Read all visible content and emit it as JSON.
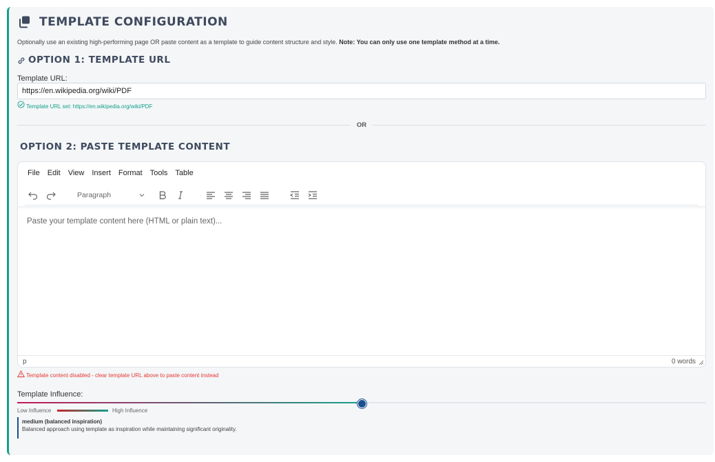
{
  "header": {
    "title": "Template Configuration",
    "icon": "copy-icon",
    "subtitle": "Optionally use an existing high-performing page OR paste content as a template to guide content structure and style.",
    "note": "Note: You can only use one template method at a time."
  },
  "option1": {
    "title": "Option 1: Template URL",
    "icon": "link-icon",
    "url_label": "Template URL:",
    "url_value": "https://en.wikipedia.org/wiki/PDF",
    "status": "Template URL set: https://en.wikipedia.org/wiki/PDF"
  },
  "divider": {
    "text": "OR"
  },
  "option2": {
    "title": "Option 2: Paste Template Content",
    "menu": [
      "File",
      "Edit",
      "View",
      "Insert",
      "Format",
      "Tools",
      "Table"
    ],
    "block_format": "Paragraph",
    "placeholder": "Paste your template content here (HTML or plain text)...",
    "path": "p",
    "word_count": "0 words",
    "warning": "Template content disabled - clear template URL above to paste content instead"
  },
  "influence": {
    "label": "Template Influence:",
    "value": 0.5,
    "low_label": "Low Influence",
    "high_label": "High Influence",
    "level_title": "medium (balanced inspiration)",
    "level_desc": "Balanced approach using template as inspiration while maintaining significant originality."
  },
  "colors": {
    "accent": "#14a089",
    "warning": "#e53935",
    "thumb": "#1a4f8f"
  }
}
